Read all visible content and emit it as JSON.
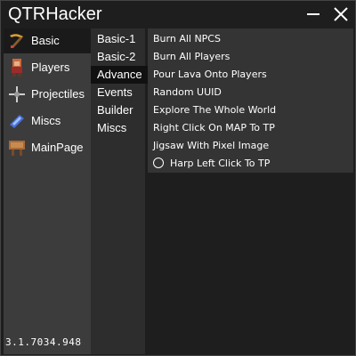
{
  "app": {
    "title": "QTRHacker",
    "version": "3.1.7034.948"
  },
  "window_controls": {
    "minimize_icon": "minimize-icon",
    "close_icon": "close-icon"
  },
  "sidebar": {
    "items": [
      {
        "label": "Basic",
        "icon": "pickaxe-icon",
        "active": true
      },
      {
        "label": "Players",
        "icon": "player-icon",
        "active": false
      },
      {
        "label": "Projectiles",
        "icon": "projectile-icon",
        "active": false
      },
      {
        "label": "Miscs",
        "icon": "crystal-icon",
        "active": false
      },
      {
        "label": "MainPage",
        "icon": "signboard-icon",
        "active": false
      }
    ]
  },
  "subnav": {
    "items": [
      {
        "label": "Basic-1",
        "active": false
      },
      {
        "label": "Basic-2",
        "active": false
      },
      {
        "label": "Advance",
        "active": true
      },
      {
        "label": "Events",
        "active": false
      },
      {
        "label": "Builder",
        "active": false
      },
      {
        "label": "Miscs",
        "active": false
      }
    ]
  },
  "content": {
    "options": [
      {
        "label": "Burn All NPCS",
        "type": "button"
      },
      {
        "label": "Burn All Players",
        "type": "button"
      },
      {
        "label": "Pour Lava Onto Players",
        "type": "button"
      },
      {
        "label": "Random UUID",
        "type": "button"
      },
      {
        "label": "Explore The Whole World",
        "type": "button"
      },
      {
        "label": "Right Click On MAP To TP",
        "type": "button"
      },
      {
        "label": "Jigsaw With Pixel Image",
        "type": "button"
      },
      {
        "label": "Harp Left Click To TP",
        "type": "radio",
        "checked": false
      }
    ]
  },
  "colors": {
    "window_bg": "#1e1e1e",
    "sidebar_bg": "#3c3c3c",
    "sidebar_active_bg": "#1a1a1a",
    "subnav_bg": "#2d2d2d",
    "subnav_active_bg": "#111111",
    "content_bg": "#343434",
    "text": "#ffffff"
  }
}
